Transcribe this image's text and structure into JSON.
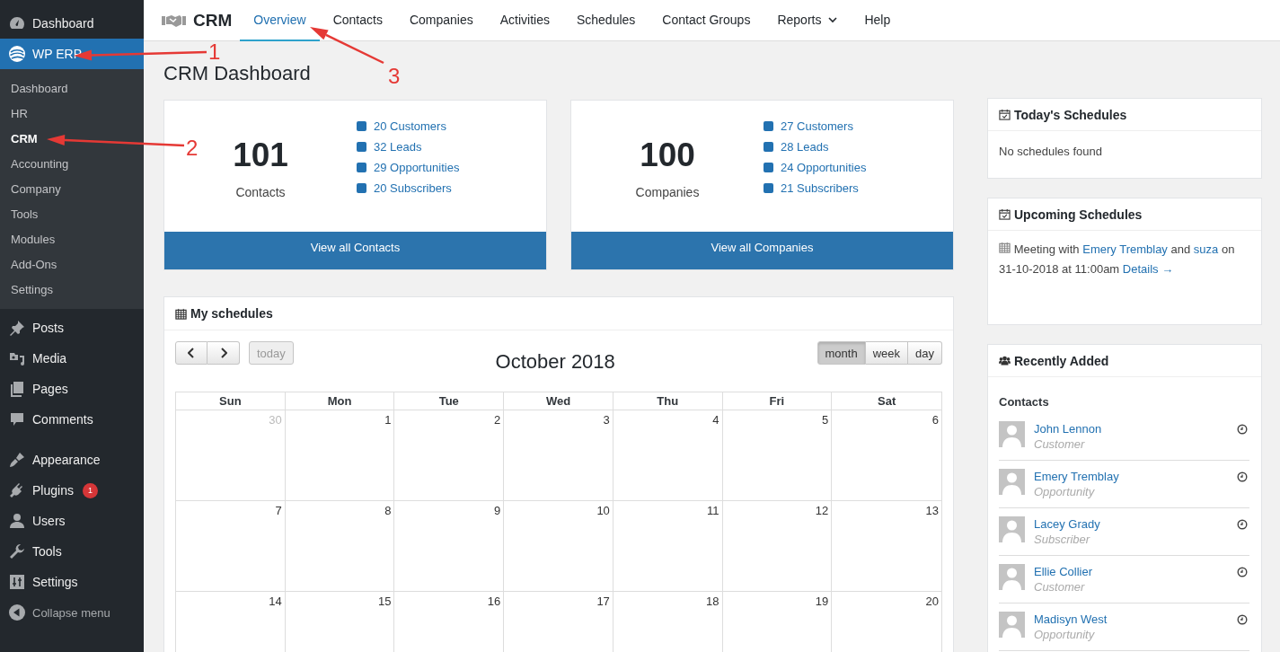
{
  "sidebar": {
    "items": [
      {
        "label": "Dashboard",
        "selected": false
      },
      {
        "label": "WP ERP",
        "selected": true,
        "children": [
          {
            "label": "Dashboard",
            "selected": false
          },
          {
            "label": "HR",
            "selected": false
          },
          {
            "label": "CRM",
            "selected": true
          },
          {
            "label": "Accounting",
            "selected": false
          },
          {
            "label": "Company",
            "selected": false
          },
          {
            "label": "Tools",
            "selected": false
          },
          {
            "label": "Modules",
            "selected": false
          },
          {
            "label": "Add-Ons",
            "selected": false
          },
          {
            "label": "Settings",
            "selected": false
          }
        ]
      },
      {
        "label": "Posts",
        "selected": false
      },
      {
        "label": "Media",
        "selected": false
      },
      {
        "label": "Pages",
        "selected": false
      },
      {
        "label": "Comments",
        "selected": false
      },
      {
        "label": "Appearance",
        "selected": false
      },
      {
        "label": "Plugins",
        "selected": false,
        "badge": "1"
      },
      {
        "label": "Users",
        "selected": false
      },
      {
        "label": "Tools",
        "selected": false
      },
      {
        "label": "Settings",
        "selected": false
      }
    ],
    "collapse": "Collapse menu"
  },
  "topbar": {
    "title": "CRM",
    "tabs": [
      {
        "label": "Overview",
        "selected": true,
        "kind": "link"
      },
      {
        "label": "Contacts",
        "selected": false,
        "kind": "link"
      },
      {
        "label": "Companies",
        "selected": false,
        "kind": "link"
      },
      {
        "label": "Activities",
        "selected": false,
        "kind": "link"
      },
      {
        "label": "Schedules",
        "selected": false,
        "kind": "link"
      },
      {
        "label": "Contact Groups",
        "selected": false,
        "kind": "link"
      },
      {
        "label": "Reports",
        "selected": false,
        "kind": "dropdown"
      },
      {
        "label": "Help",
        "selected": false,
        "kind": "link"
      }
    ]
  },
  "page_title": "CRM Dashboard",
  "stat_cards": [
    {
      "count": "101",
      "label": "Contacts",
      "stats": [
        "20 Customers",
        "32 Leads",
        "29 Opportunities",
        "20 Subscribers"
      ],
      "button": "View all Contacts"
    },
    {
      "count": "100",
      "label": "Companies",
      "stats": [
        "27 Customers",
        "28 Leads",
        "24 Opportunities",
        "21 Subscribers"
      ],
      "button": "View all Companies"
    }
  ],
  "my_schedules": {
    "title": "My schedules",
    "today": "today",
    "month_title": "October 2018",
    "views": [
      {
        "label": "month",
        "selected": true
      },
      {
        "label": "week",
        "selected": false
      },
      {
        "label": "day",
        "selected": false
      }
    ],
    "weekdays": [
      "Sun",
      "Mon",
      "Tue",
      "Wed",
      "Thu",
      "Fri",
      "Sat"
    ],
    "weeks": [
      [
        {
          "day": "30",
          "other_month": true
        },
        {
          "day": "1",
          "other_month": false
        },
        {
          "day": "2",
          "other_month": false
        },
        {
          "day": "3",
          "other_month": false
        },
        {
          "day": "4",
          "other_month": false
        },
        {
          "day": "5",
          "other_month": false
        },
        {
          "day": "6",
          "other_month": false
        }
      ],
      [
        {
          "day": "7",
          "other_month": false
        },
        {
          "day": "8",
          "other_month": false
        },
        {
          "day": "9",
          "other_month": false
        },
        {
          "day": "10",
          "other_month": false
        },
        {
          "day": "11",
          "other_month": false
        },
        {
          "day": "12",
          "other_month": false
        },
        {
          "day": "13",
          "other_month": false
        }
      ],
      [
        {
          "day": "14",
          "other_month": false
        },
        {
          "day": "15",
          "other_month": false
        },
        {
          "day": "16",
          "other_month": false
        },
        {
          "day": "17",
          "other_month": false
        },
        {
          "day": "18",
          "other_month": false
        },
        {
          "day": "19",
          "other_month": false
        },
        {
          "day": "20",
          "other_month": false
        }
      ]
    ]
  },
  "todays_schedules": {
    "title": "Today's Schedules",
    "message": "No schedules found"
  },
  "upcoming_schedules": {
    "title": "Upcoming Schedules",
    "text": "Meeting with",
    "person_1": "Emery Tremblay",
    "and": "and",
    "person_2": "suza",
    "on": "on",
    "when": "31-10-2018 at 11:00am",
    "details": "Details →"
  },
  "recently_added": {
    "title": "Recently Added",
    "section": "Contacts",
    "contacts": [
      {
        "name": "John Lennon",
        "type": "Customer"
      },
      {
        "name": "Emery Tremblay",
        "type": "Opportunity"
      },
      {
        "name": "Lacey Grady",
        "type": "Subscriber"
      },
      {
        "name": "Ellie Collier",
        "type": "Customer"
      },
      {
        "name": "Madisyn West",
        "type": "Opportunity"
      }
    ]
  },
  "annotations": [
    {
      "label": "1"
    },
    {
      "label": "2"
    },
    {
      "label": "3"
    }
  ]
}
